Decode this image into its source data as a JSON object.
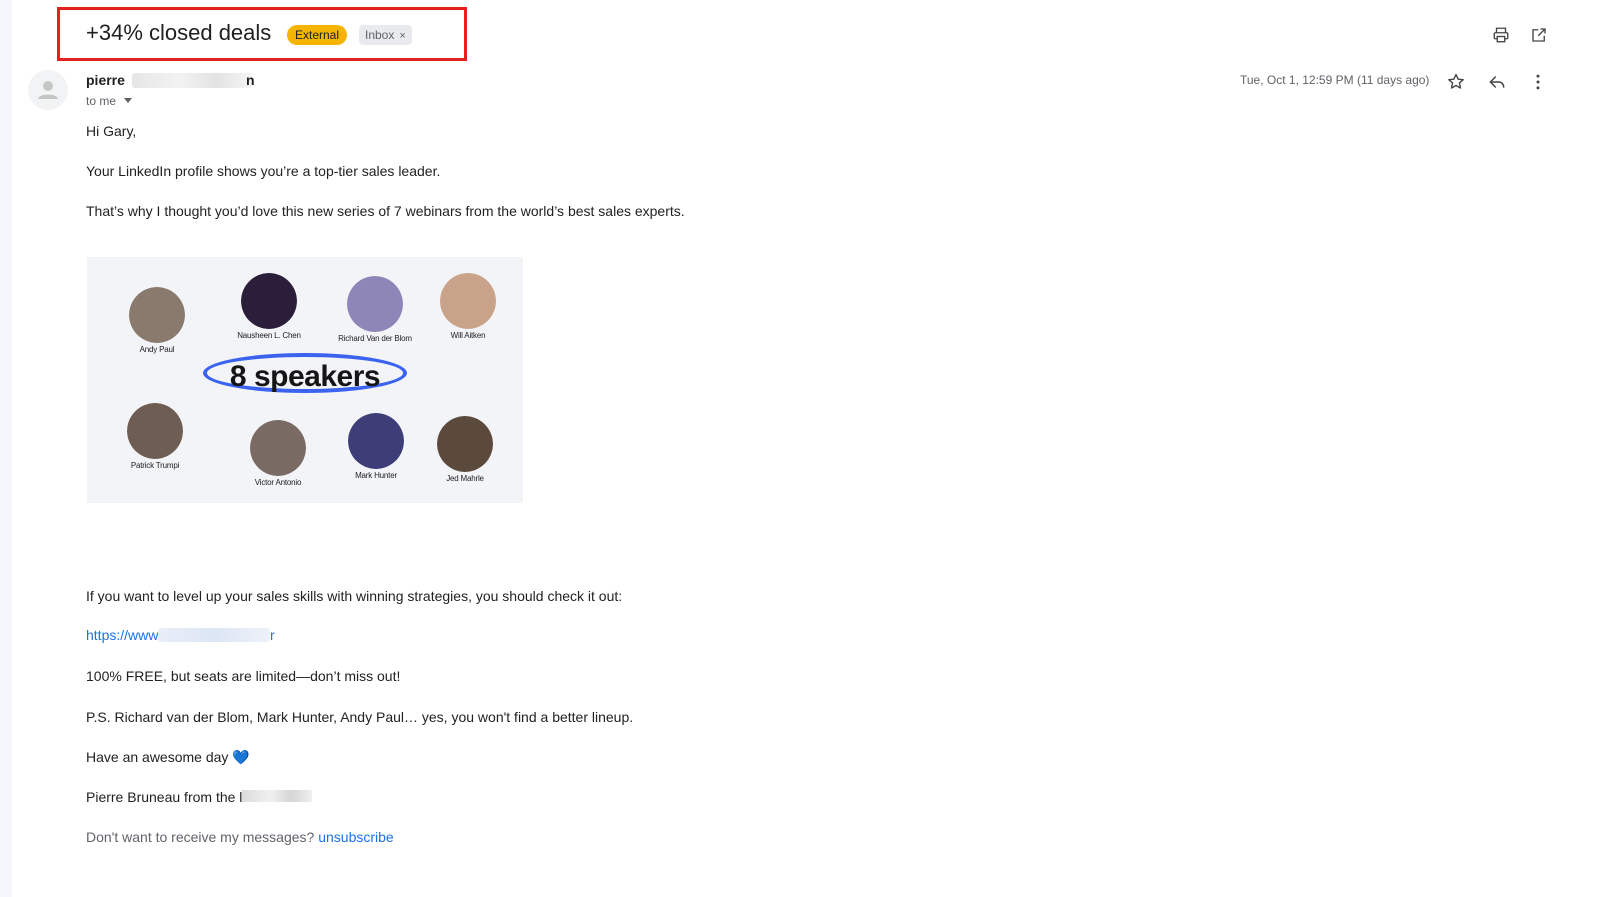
{
  "email": {
    "subject": "+34% closed deals",
    "labels": {
      "external": "External",
      "inbox": "Inbox",
      "remove_glyph": "×"
    },
    "sender_visible_prefix": "pierre",
    "sender_visible_suffix": "n",
    "recipient_text": "to me",
    "date": "Tue, Oct 1, 12:59 PM (11 days ago)"
  },
  "toolbar_icons": [
    "print-icon",
    "open-in-new-window-icon"
  ],
  "message_actions_icons": [
    "star-icon",
    "reply-icon",
    "more-vert-icon"
  ],
  "body": {
    "greeting": "Hi Gary,",
    "p1": "Your LinkedIn profile shows you’re a top-tier sales leader.",
    "p2": "That’s why I thought you’d love this new series of 7 webinars from the world’s best sales experts.",
    "p3": "If you want to level up your sales skills with winning strategies, you should check it out:",
    "link_visible_prefix": "https://www.",
    "link_visible_suffix": "r",
    "p4": "100% FREE, but seats are limited—don’t miss out!",
    "p5": "P.S. Richard van der Blom, Mark Hunter, Andy Paul… yes, you won't find a better lineup.",
    "p6": "Have an awesome day",
    "p6_emoji": "💙",
    "signature_prefix": "Pierre Bruneau from the le",
    "footer_text": "Don't want to receive my messages?",
    "unsubscribe": "unsubscribe"
  },
  "promo_image": {
    "headline": "8 speakers",
    "speakers": [
      {
        "name": "Andy Paul",
        "color": "#8a7a6e"
      },
      {
        "name": "Nausheen L. Chen",
        "color": "#2b1e3a"
      },
      {
        "name": "Richard Van der Blom",
        "color": "#8f86b8"
      },
      {
        "name": "Will Aitken",
        "color": "#c9a28a"
      },
      {
        "name": "Patrick Trumpi",
        "color": "#6d5d52"
      },
      {
        "name": "Victor Antonio",
        "color": "#7a6a64"
      },
      {
        "name": "Mark Hunter",
        "color": "#3d3e78"
      },
      {
        "name": "Jed Mahrle",
        "color": "#5b4a3c"
      }
    ]
  },
  "colors": {
    "highlight_border": "#e5211d",
    "external_chip": "#f4b400",
    "link": "#1a73e8",
    "headline_ellipse": "#3b63f0"
  }
}
